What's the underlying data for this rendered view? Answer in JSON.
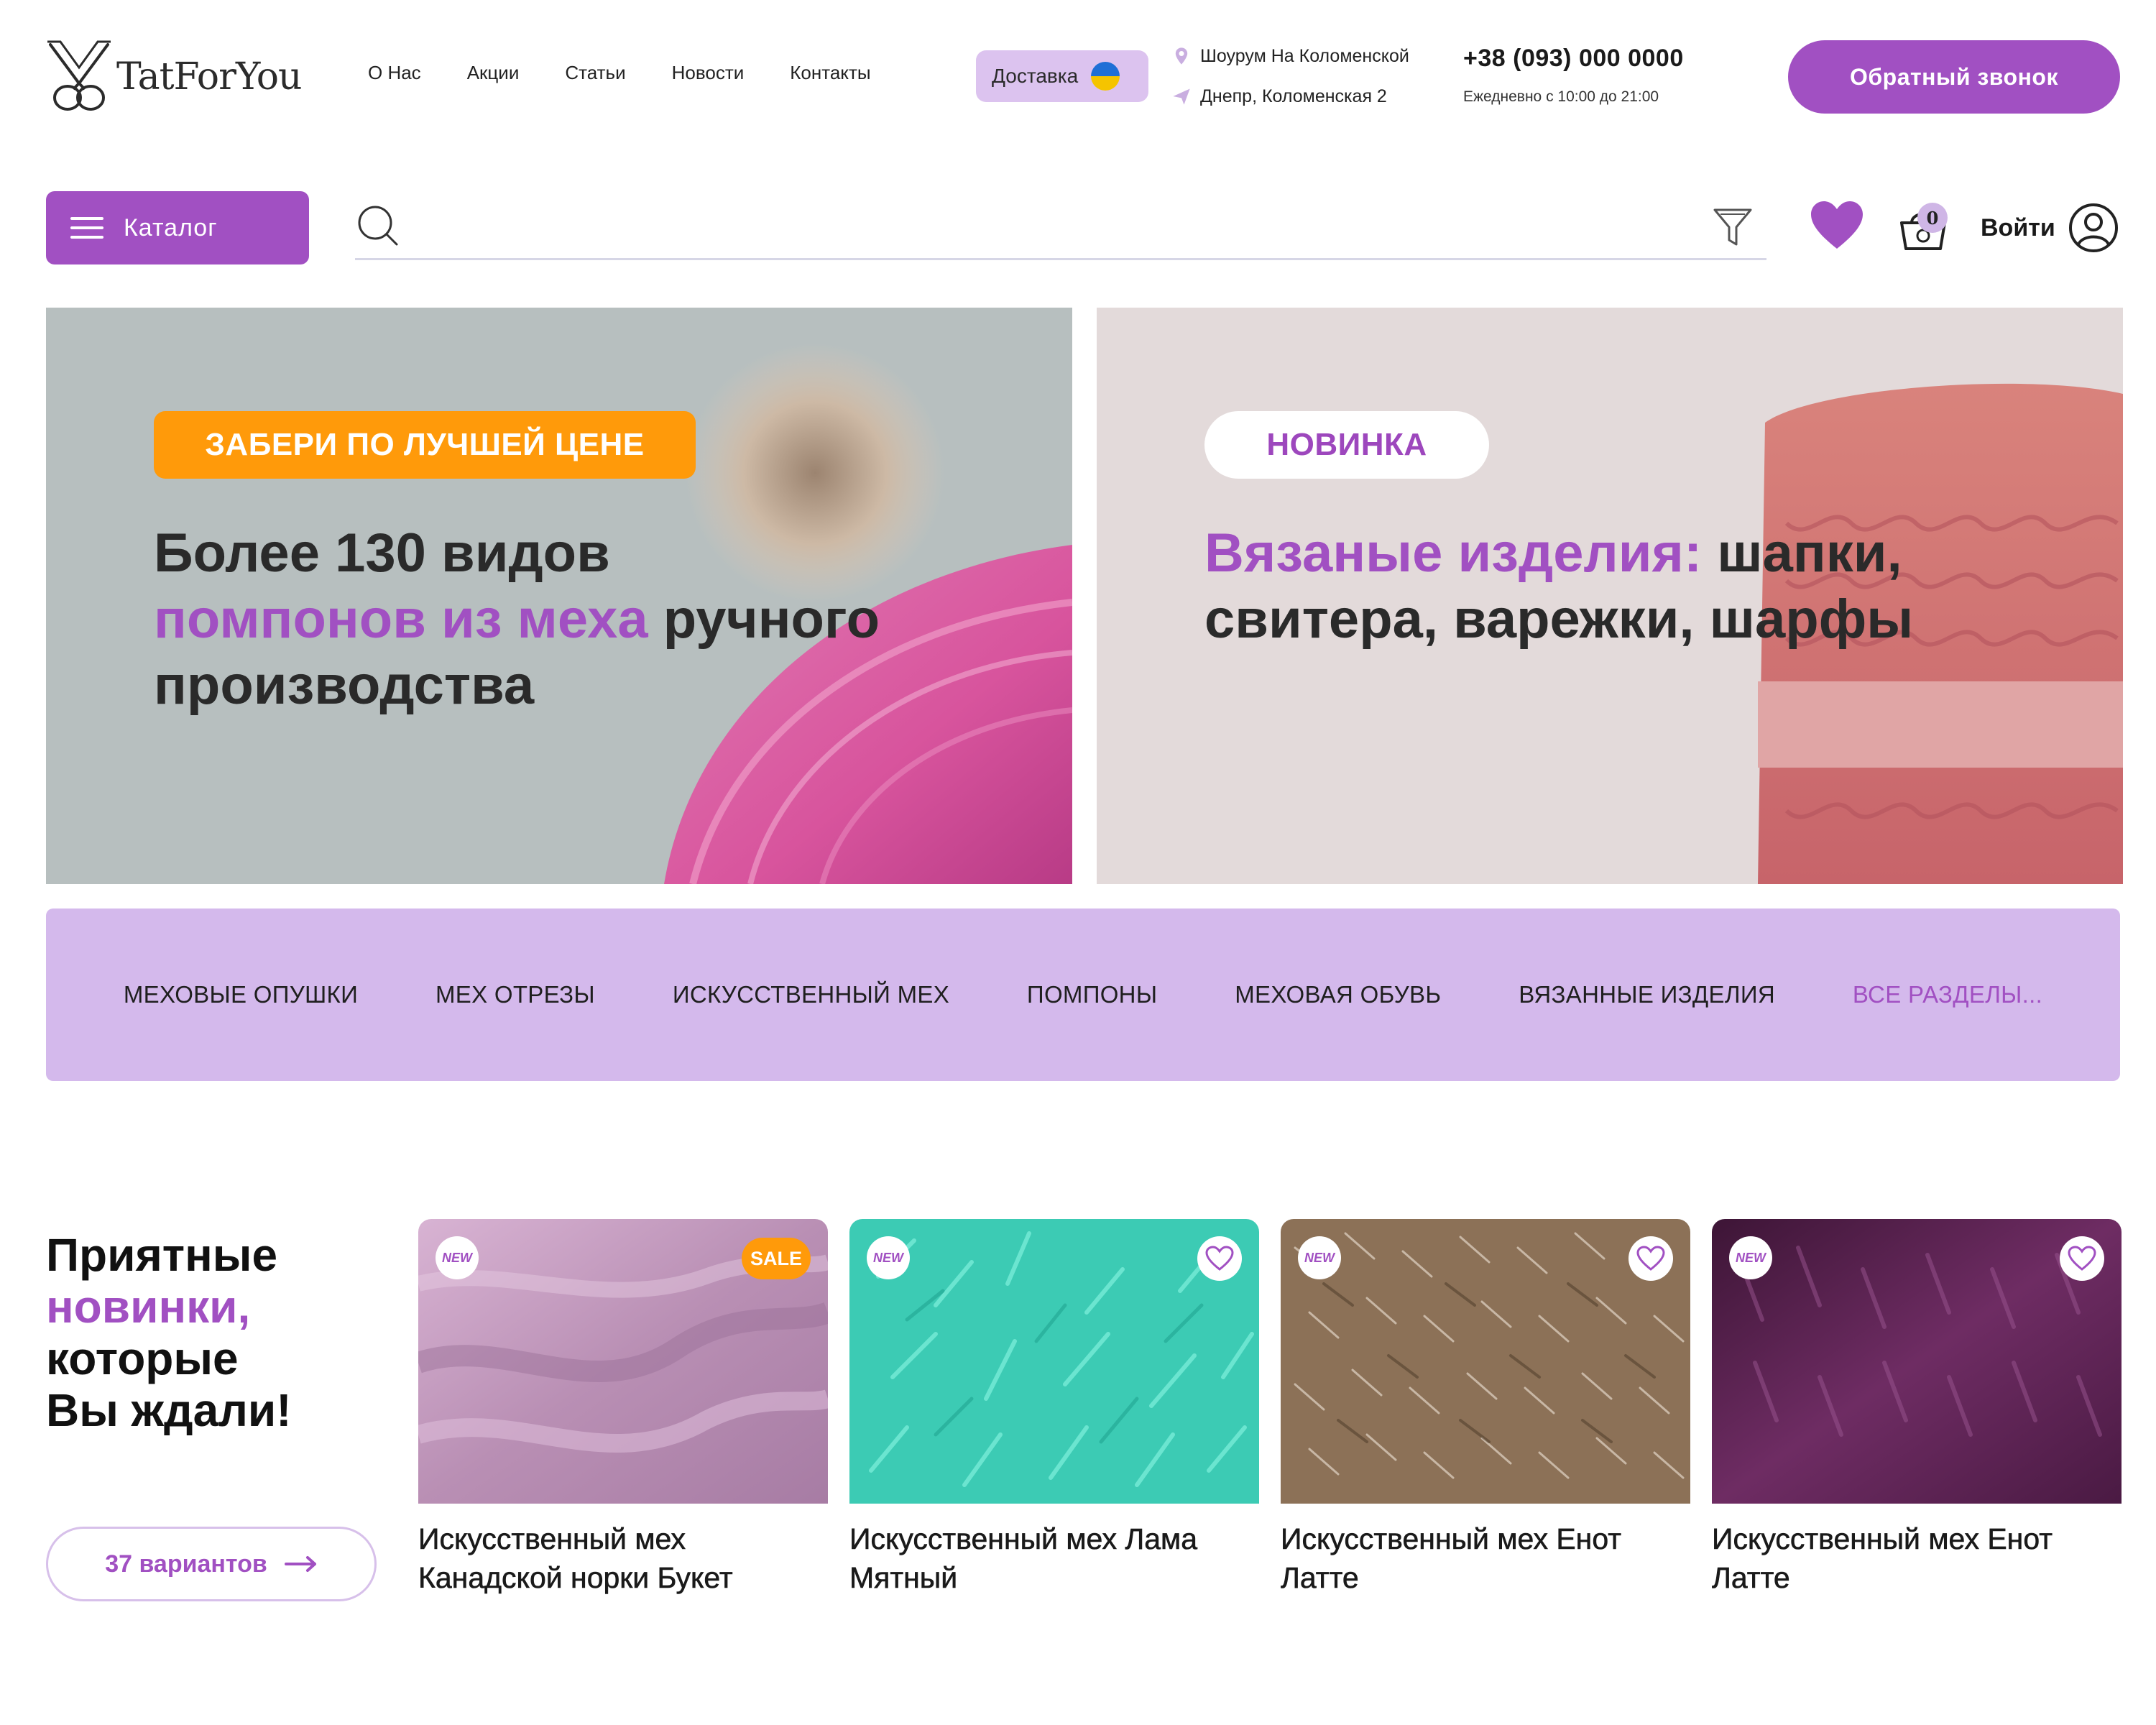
{
  "brand": {
    "logo_text": "TatForYou",
    "accent": "#a150c2",
    "accent_light": "#d4b9ec",
    "orange": "#ff9a0a"
  },
  "nav": {
    "items": [
      "О Нас",
      "Акции",
      "Статьи",
      "Новости",
      "Контакты"
    ]
  },
  "delivery": {
    "label": "Доставка",
    "flag_icon": "ukraine-flag-icon"
  },
  "address": {
    "showroom": "Шоурум На Коломенской",
    "street": "Днепр, Коломенская 2"
  },
  "contact": {
    "phone": "+38 (093) 000 0000",
    "hours": "Ежедневно с 10:00 до 21:00"
  },
  "callback": {
    "label": "Обратный звонок"
  },
  "catalog": {
    "label": "Каталог"
  },
  "search": {
    "value": "",
    "placeholder": ""
  },
  "cart": {
    "count": "0"
  },
  "login": {
    "label": "Войти"
  },
  "banners": [
    {
      "badge": "ЗАБЕРИ ПО ЛУЧШЕЙ ЦЕНЕ",
      "line1": "Более 130 видов",
      "accent": "помпонов из меха",
      "line2_rest": " ручного",
      "line3": "производства"
    },
    {
      "badge": "НОВИНКА",
      "accent": "Вязаные изделия:",
      "line1_rest": " шапки,",
      "line2": "свитера, варежки, шарфы"
    }
  ],
  "categories": [
    "МЕХОВЫЕ ОПУШКИ",
    "МЕХ ОТРЕЗЫ",
    "ИСКУССТВЕННЫЙ МЕХ",
    "ПОМПОНЫ",
    "МЕХОВАЯ ОБУВЬ",
    "ВЯЗАННЫЕ ИЗДЕЛИЯ",
    "ВСЕ РАЗДЕЛЫ..."
  ],
  "promo": {
    "line1": "Приятные",
    "accent": "новинки,",
    "line3": "которые",
    "line4": "Вы ждали!",
    "variants_label": "37 вариантов"
  },
  "products": [
    {
      "title": "Искусственный мех Канадской норки Букет",
      "badge": "NEW",
      "sale": "SALE",
      "color": "#c49bc0"
    },
    {
      "title": "Искусственный мех Лама Мятный",
      "badge": "NEW",
      "color": "#3fd6bf"
    },
    {
      "title": "Искусственный мех Енот Латте",
      "badge": "NEW",
      "color": "#8d7358"
    },
    {
      "title": "Искусственный мех Енот Латте",
      "badge": "NEW",
      "color": "#5e2452"
    }
  ]
}
